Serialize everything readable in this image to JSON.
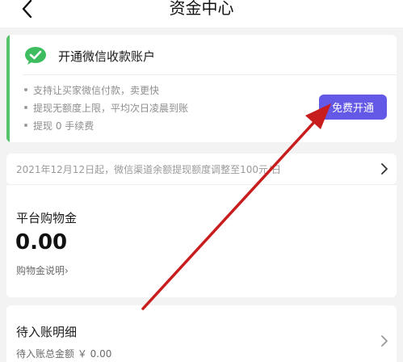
{
  "nav": {
    "title": "资金中心"
  },
  "wechat_card": {
    "title": "开通微信收款账户",
    "features": [
      "支持让买家微信付款，卖更快",
      "提现无额度上限，平均次日凌晨到账",
      "提现 0 手续费"
    ],
    "button_label": "免费开通"
  },
  "notice": {
    "text": "2021年12月12日起，微信渠道余额提现额度调整至100元/日"
  },
  "balance": {
    "label": "平台购物金",
    "amount": "0.00",
    "link_label": "购物金说明›"
  },
  "pending": {
    "title": "待入账明细",
    "total": "待入账总金额 ￥ 0.00"
  },
  "colors": {
    "accent": "#6458e6",
    "wechat_green": "#54c36a",
    "annotation_arrow": "#c81d1d"
  }
}
